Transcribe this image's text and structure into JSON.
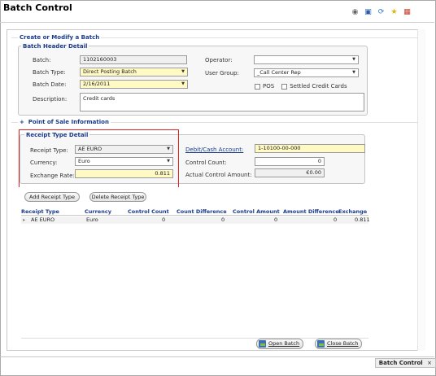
{
  "window": {
    "title": "Batch Control",
    "bottom_tab": "Batch Control",
    "bottom_tab_close": "×"
  },
  "toolbar": {
    "icons": [
      "eye-icon",
      "save-icon",
      "refresh-icon",
      "lightbulb-icon",
      "pdf-icon"
    ]
  },
  "sections": {
    "create": "Create or Modify a Batch",
    "header_detail": "Batch Header Detail",
    "pos": "Point of Sale Information",
    "pos_toggle": "+",
    "receipt_detail": "Receipt Type Detail"
  },
  "header": {
    "batch_label": "Batch:",
    "batch_value": "1102160003",
    "batch_type_label": "Batch Type:",
    "batch_type_value": "Direct Posting Batch",
    "batch_date_label": "Batch Date:",
    "batch_date_value": "2/16/2011",
    "description_label": "Description:",
    "description_value": "Credit cards",
    "operator_label": "Operator:",
    "operator_value": "",
    "user_group_label": "User Group:",
    "user_group_value": "_Call Center Rep",
    "pos_label": "POS",
    "settled_label": "Settled Credit Cards"
  },
  "receipt": {
    "receipt_type_label": "Receipt Type:",
    "receipt_type_value": "AE EURO",
    "currency_label": "Currency:",
    "currency_value": "Euro",
    "exchange_rate_label": "Exchange Rate:",
    "exchange_rate_value": "0.811",
    "gl_account_label": "Debit/Cash Account:",
    "gl_account_value": "1-10100-00-000",
    "control_count_label": "Control Count:",
    "control_count_value": "0",
    "actual_amount_label": "Actual Control Amount:",
    "actual_amount_value": "€0.00"
  },
  "buttons": {
    "add_receipt_type": "Add Receipt Type",
    "delete_receipt_type": "Delete Receipt Type",
    "open_batch": "Open Batch",
    "close_batch": "Close Batch"
  },
  "grid": {
    "columns": [
      "Receipt Type",
      "Currency",
      "Control Count",
      "Count Difference",
      "Control Amount",
      "Amount Difference",
      "Exchange"
    ],
    "rows": [
      [
        "AE EURO",
        "Euro",
        "0",
        "0",
        "0",
        "0",
        "0.811"
      ]
    ],
    "row_marker": "▸"
  }
}
